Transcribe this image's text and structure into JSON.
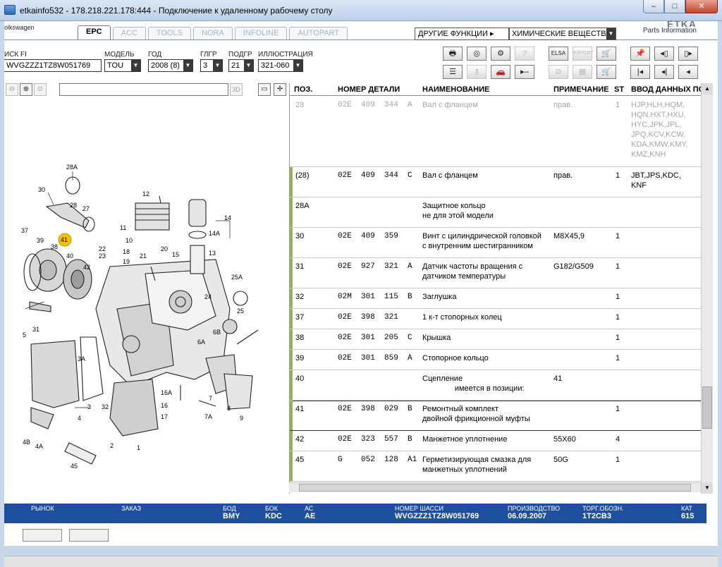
{
  "window": {
    "title": "etkainfo532 - 178.218.221.178:444 - Подключение к удаленному рабочему столу",
    "min": "–",
    "max": "□",
    "close": "✕"
  },
  "brand": {
    "left": "olkswagen",
    "right_big": "ETKA",
    "right_small": "Parts Information"
  },
  "tabs": [
    {
      "label": "EPC",
      "active": true
    },
    {
      "label": "ACC",
      "active": false
    },
    {
      "label": "TOOLS",
      "active": false
    },
    {
      "label": "NORA",
      "active": false
    },
    {
      "label": "INFOLINE",
      "active": false
    },
    {
      "label": "AUTOPART",
      "active": false
    }
  ],
  "functions": {
    "label": "ДРУГИЕ ФУНКЦИИ ▸",
    "value": "ХИМИЧЕСКИЕ ВЕЩЕСТВА"
  },
  "filters": {
    "vin": {
      "label": "ИСК FI",
      "value": "WVGZZZ1TZ8W051769"
    },
    "model": {
      "label": "МОДЕЛЬ",
      "value": "TOU"
    },
    "year": {
      "label": "ГОД",
      "value": "2008 (8)"
    },
    "mg": {
      "label": "ГЛГР",
      "value": "3"
    },
    "sg": {
      "label": "ПОДГР",
      "value": "21"
    },
    "illus": {
      "label": "ИЛЛЮСТРАЦИЯ",
      "value": "321-060"
    }
  },
  "toolbar": {
    "print": "🖶",
    "cd": "◎",
    "parts": "⚙",
    "find": "?",
    "elsa": "ELSA",
    "export": "EXPORT",
    "cart_add": "🛒",
    "pin": "📌",
    "prev_page": "◂▯",
    "next_page": "▯▸",
    "list": "☰",
    "key": "⚷",
    "car": "🚗",
    "minus": "▸–",
    "copy": "⧉",
    "print2": "▦",
    "cart": "🛒",
    "first": "|◂",
    "back": "◂|",
    "left": "◂"
  },
  "imgtools": {
    "zoom_out": "⊖",
    "zoom_in": "⊕",
    "zoom_fit": "⊙",
    "three_d": "3D",
    "view": "▭",
    "pan": "✛"
  },
  "columns": {
    "pos": "ПОЗ.",
    "part": "НОМЕР ДЕТАЛИ",
    "name": "НАИМЕНОВАНИЕ",
    "note": "ПРИМЕЧАНИЕ",
    "st": "ST",
    "model": "ВВОД ДАННЫХ ПО МОДЕЛЯМ"
  },
  "rows": [
    {
      "pos": "28",
      "part": "02E  409  344  A",
      "name": "Вал с фланцем",
      "note": "прав.",
      "st": "1",
      "model": "HJP,HLH,HQM,\nHQN,HXT,HXU,\nHYC,JPK,JPL,\nJPQ,KCV,KCW,\nKDA,KMW,KMY,\nKMZ,KNH",
      "h": 100,
      "first": true
    },
    {
      "pos": "(28)",
      "part": "02E  409  344  C",
      "name": "Вал с фланцем",
      "note": "прав.",
      "st": "1",
      "model": "JBT,JPS,KDC,\nKNF",
      "h": 43
    },
    {
      "pos": "28A",
      "part": "",
      "name": "Защитное кольцо\nне для этой модели",
      "note": "",
      "st": "",
      "model": "",
      "h": 43
    },
    {
      "pos": "30",
      "part": "02E  409  359",
      "name": "Винт с цилиндрической головкой\nс внутренним шестигранником",
      "note": "M8X45,9",
      "st": "1",
      "model": "",
      "h": 43
    },
    {
      "pos": "31",
      "part": "02E  927  321  A",
      "name": "Датчик частоты вращения с\nдатчиком температуры",
      "note": "G182/G509",
      "st": "1",
      "model": "",
      "h": 43
    },
    {
      "pos": "32",
      "part": "02M  301  115  B",
      "name": "Заглушка",
      "note": "",
      "st": "1",
      "model": "",
      "h": 29
    },
    {
      "pos": "37",
      "part": "02E  398  321",
      "name": "1 к-т стопорных колец",
      "note": "",
      "st": "1",
      "model": "",
      "h": 29
    },
    {
      "pos": "38",
      "part": "02E  301  205  C",
      "name": "Крышка",
      "note": "",
      "st": "1",
      "model": "",
      "h": 29
    },
    {
      "pos": "39",
      "part": "02E  301  859  A",
      "name": "Стопорное кольцо",
      "note": "",
      "st": "1",
      "model": "",
      "h": 29
    },
    {
      "pos": "40",
      "part": "",
      "name": "Сцепление\n               имеется в позиции:",
      "note": "41",
      "st": "",
      "model": "",
      "h": 43
    },
    {
      "pos": "41",
      "part": "02E  398  029  B",
      "name": "Ремонтный комплект\nдвойной фрикционной муфты",
      "note": "",
      "st": "1",
      "model": "",
      "h": 43,
      "selected": true
    },
    {
      "pos": "42",
      "part": "02E  323  557  B",
      "name": "Манжетное уплотнение",
      "note": "55X60",
      "st": "4",
      "model": "",
      "h": 29
    },
    {
      "pos": "45",
      "part": "G    052  128  A1",
      "name": "Герметизирующая смазка для\nманжетных уплотнений",
      "note": "50G",
      "st": "1",
      "model": "",
      "h": 43
    }
  ],
  "status": {
    "market": {
      "label": "РЫНОК",
      "value": ""
    },
    "order": {
      "label": "ЗАКАЗ",
      "value": ""
    },
    "engine": {
      "label": "БОД",
      "value": "BMY"
    },
    "gearbox": {
      "label": "БОК",
      "value": "KDC"
    },
    "axle": {
      "label": "АС",
      "value": "AE"
    },
    "chassis": {
      "label": "НОМЕР ШАССИ",
      "value": "WVGZZZ1TZ8W051769"
    },
    "production": {
      "label": "ПРОИЗВОДСТВО",
      "value": "06.09.2007"
    },
    "trade": {
      "label": "ТОРГ.ОБОЗН.",
      "value": "1T2CB3"
    },
    "cat": {
      "label": "КАТ",
      "value": "615"
    }
  },
  "callouts": [
    "28A",
    "30",
    "28",
    "27",
    "12",
    "11",
    "10",
    "14",
    "14A",
    "13",
    "37",
    "39",
    "41",
    "38",
    "40",
    "42",
    "22",
    "23",
    "18",
    "19",
    "21",
    "20",
    "15",
    "25A",
    "24",
    "25",
    "6B",
    "31",
    "5",
    "3A",
    "3",
    "32",
    "4",
    "4B",
    "4A",
    "45",
    "2",
    "1",
    "16A",
    "16",
    "17",
    "7",
    "7A",
    "6A",
    "8",
    "9"
  ]
}
